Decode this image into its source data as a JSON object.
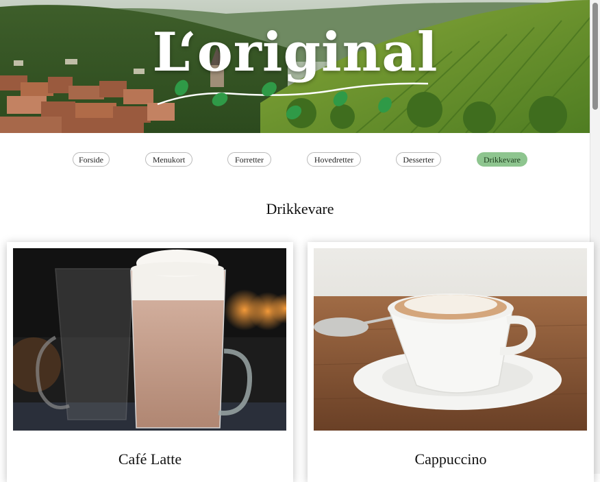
{
  "header": {
    "logo_text": "L‘original"
  },
  "nav": {
    "items": [
      {
        "label": "Forside",
        "active": false
      },
      {
        "label": "Menukort",
        "active": false
      },
      {
        "label": "Forretter",
        "active": false
      },
      {
        "label": "Hovedretter",
        "active": false
      },
      {
        "label": "Desserter",
        "active": false
      },
      {
        "label": "Drikkevare",
        "active": true
      }
    ]
  },
  "main": {
    "section_title": "Drikkevare",
    "products": [
      {
        "name": "Café Latte",
        "image": "cafe-latte-photo"
      },
      {
        "name": "Cappuccino",
        "image": "cappuccino-photo"
      }
    ]
  },
  "colors": {
    "active_nav": "#8ec58f",
    "nav_border": "#b9b9b9"
  }
}
